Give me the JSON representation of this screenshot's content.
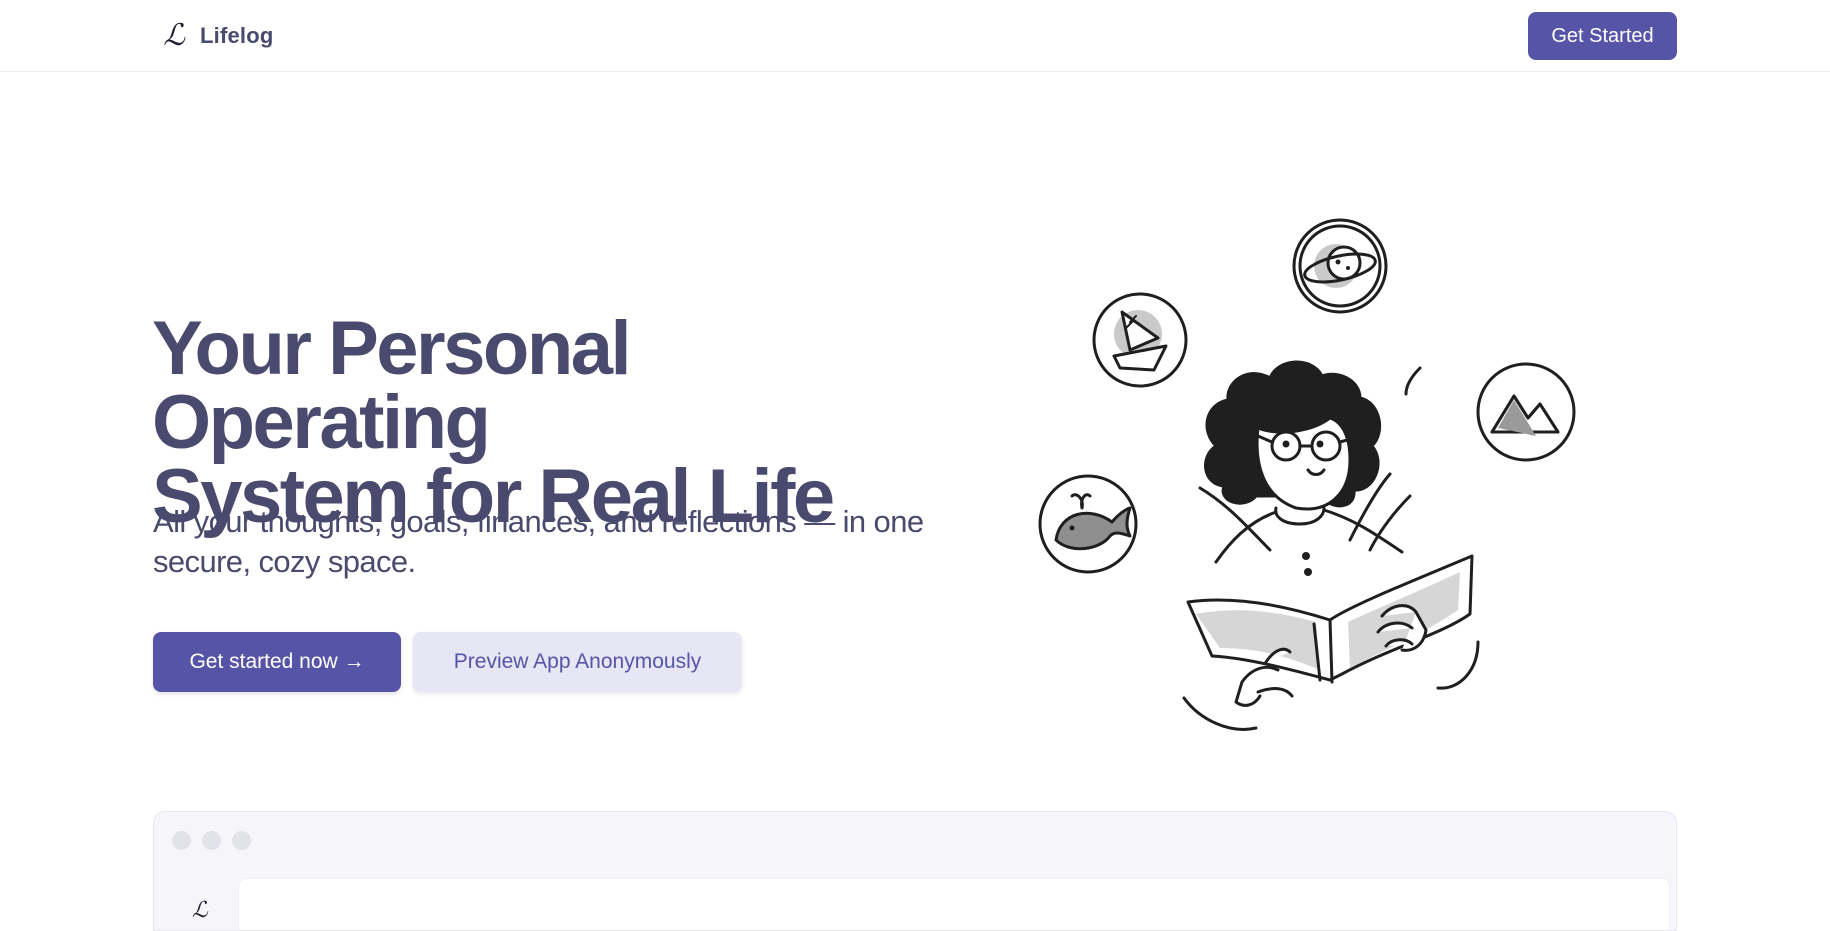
{
  "header": {
    "brand_logo": "ℒ",
    "brand_name": "Lifelog",
    "cta_label": "Get Started"
  },
  "hero": {
    "title_line1": "Your Personal Operating",
    "title_line2": "System for Real Life",
    "subtitle": "All your thoughts, goals, finances, and reflections — in one secure, cozy space.",
    "primary_cta": "Get started now →",
    "secondary_cta": "Preview App Anonymously"
  },
  "illustration": {
    "subject": "person-reading-book-icon",
    "orbit_icons": [
      "planet-icon",
      "sailboat-icon",
      "mountain-icon",
      "whale-icon"
    ]
  },
  "preview": {
    "logo": "ℒ"
  },
  "colors": {
    "primary": "#5654a6",
    "text": "#4a4a6e",
    "secondary_bg": "#e6e6f4",
    "border": "#ececf2"
  }
}
